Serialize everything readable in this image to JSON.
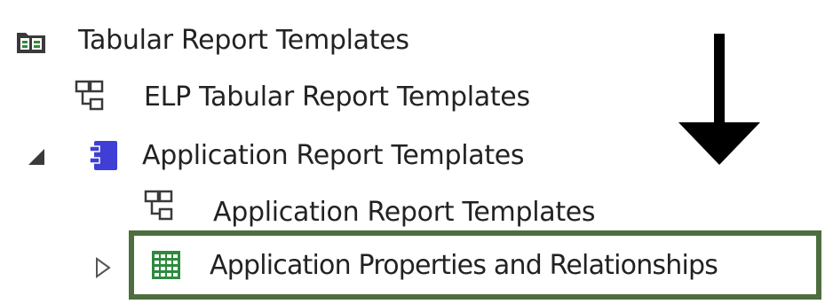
{
  "tree": {
    "items": [
      {
        "label": "Tabular Report Templates",
        "icon": "package-folder-icon",
        "level": 0
      },
      {
        "label": "ELP Tabular Report Templates",
        "icon": "diagram-icon",
        "level": 1
      },
      {
        "label": "Application Report Templates",
        "icon": "component-icon",
        "level": 1,
        "expanded": true
      },
      {
        "label": "Application Report Templates",
        "icon": "diagram-icon",
        "level": 2
      },
      {
        "label": "Application Properties and Relationships",
        "icon": "table-grid-icon",
        "level": 2,
        "expanded": false,
        "highlighted": true
      }
    ]
  },
  "colors": {
    "highlight_border": "#4e6e3f",
    "component_icon": "#3f3fd6",
    "table_icon": "#2f8a3e",
    "folder_icon": "#3a3a3a"
  }
}
